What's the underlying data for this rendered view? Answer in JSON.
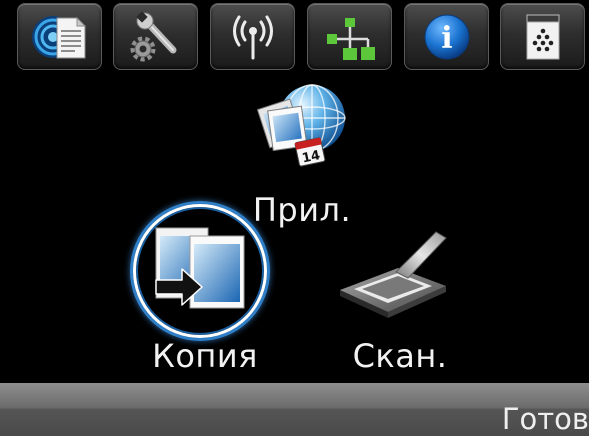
{
  "top_bar": {
    "buttons": [
      {
        "icon": "web-services-icon"
      },
      {
        "icon": "setup-wrench-gear-icon"
      },
      {
        "icon": "wireless-icon"
      },
      {
        "icon": "network-icon"
      },
      {
        "icon": "info-icon",
        "glyph": "i"
      },
      {
        "icon": "supplies-icon"
      }
    ]
  },
  "apps": {
    "label": "Прил.",
    "icon": "apps-globe-calendar-icon",
    "calendar_day": "14"
  },
  "copy": {
    "label": "Копия",
    "icon": "copy-icon",
    "selected": true
  },
  "scan": {
    "label": "Скан.",
    "icon": "scanner-icon"
  },
  "status_bar": {
    "text": "Готов"
  },
  "colors": {
    "background": "#000000",
    "label_text": "#f2f2f2",
    "selection_ring": "#ffffff",
    "selection_glow": "#2f7fc8",
    "info_blue": "#1a73d0",
    "network_green": "#5cc73a",
    "calendar_red": "#c82020",
    "status_bar": "#6c6c6c"
  }
}
